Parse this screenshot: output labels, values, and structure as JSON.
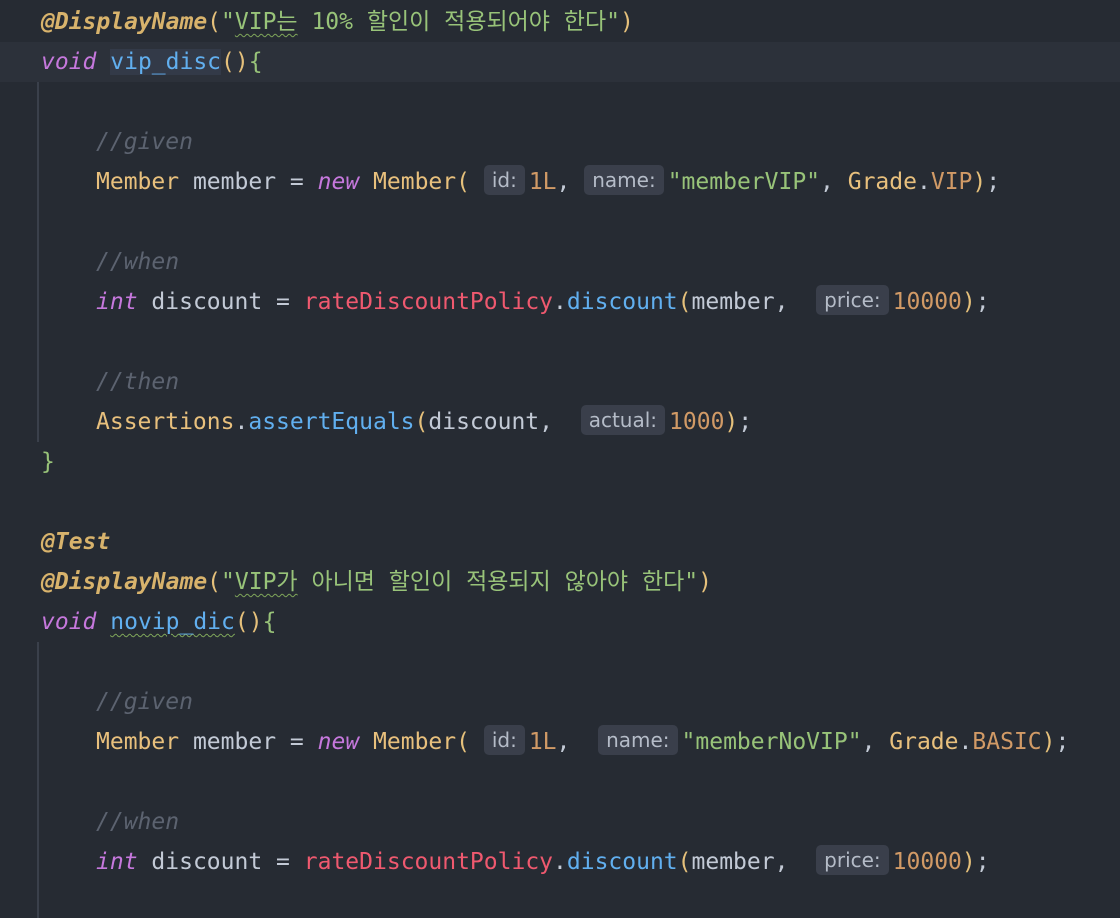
{
  "test1": {
    "annotation": "@DisplayName",
    "display_name": "\"VIP는 10% 할인이 적용되어야 한다\"",
    "display_name_squiggle": "VIP는",
    "display_name_rest": " 10% 할인이 적용되어야 한다\"",
    "void_kw": "void",
    "method_name": "vip_disc",
    "given_comment": "//given",
    "member_type": "Member",
    "member_var": "member",
    "assign": "=",
    "new_kw": "new",
    "ctor": "Member",
    "hint_id": "id:",
    "id_value": "1L",
    "hint_name": "name:",
    "name_value": "\"memberVIP\"",
    "grade_class": "Grade",
    "grade_value": "VIP",
    "when_comment": "//when",
    "int_kw": "int",
    "discount_var": "discount",
    "policy_field": "rateDiscountPolicy",
    "discount_method": "discount",
    "member_arg": "member,",
    "hint_price": "price:",
    "price_value": "10000",
    "then_comment": "//then",
    "assertions_class": "Assertions",
    "assert_method": "assertEquals",
    "discount_arg": "discount,",
    "hint_actual": "actual:",
    "expected_value": "1000"
  },
  "test2": {
    "test_annotation": "@Test",
    "annotation": "@DisplayName",
    "display_name_squiggle": "VIP가",
    "display_name_rest": " 아니면 할인이 적용되지 않아야 한다\"",
    "void_kw": "void",
    "method_name": "novip_dic",
    "given_comment": "//given",
    "member_type": "Member",
    "member_var": "member",
    "assign": "=",
    "new_kw": "new",
    "ctor": "Member",
    "hint_id": "id:",
    "id_value": "1L",
    "hint_name": "name:",
    "name_value": "\"memberNoVIP\"",
    "grade_class": "Grade",
    "grade_value": "BASIC",
    "when_comment": "//when",
    "int_kw": "int",
    "discount_var": "discount",
    "policy_field": "rateDiscountPolicy",
    "discount_method": "discount",
    "member_arg": "member,",
    "hint_price": "price:",
    "price_value": "10000"
  },
  "colors": {
    "background": "#262b33",
    "annotation": "#d8b36c",
    "keyword": "#c678dd",
    "string": "#98c379",
    "function": "#61afef",
    "field": "#ef596f",
    "number": "#d19a66",
    "comment": "#5c6370"
  }
}
